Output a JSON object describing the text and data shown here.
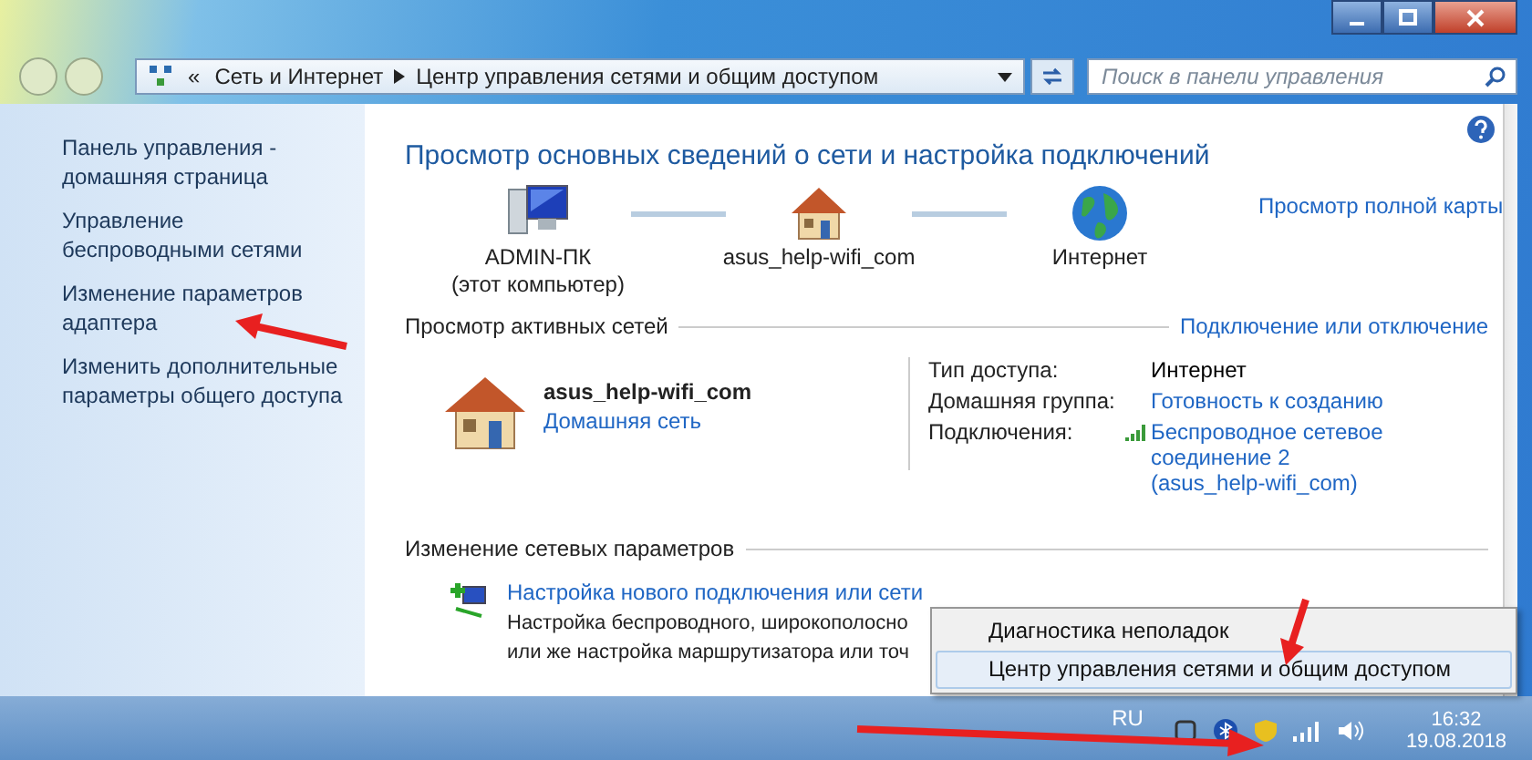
{
  "address_bar": {
    "overflow_mark": "«",
    "breadcrumbs": [
      "Сеть и Интернет",
      "Центр управления сетями и общим доступом"
    ]
  },
  "search": {
    "placeholder": "Поиск в панели управления"
  },
  "sidebar": {
    "items": [
      {
        "label": "Панель управления - домашняя страница"
      },
      {
        "label": "Управление беспроводными сетями"
      },
      {
        "label": "Изменение параметров адаптера"
      },
      {
        "label": "Изменить дополнительные параметры общего доступа"
      }
    ]
  },
  "main": {
    "title": "Просмотр основных сведений о сети и настройка подключений",
    "map": {
      "nodes": [
        {
          "kind": "computer",
          "label": "ADMIN-ПК",
          "sublabel": "(этот компьютер)"
        },
        {
          "kind": "house",
          "label": "asus_help-wifi_com"
        },
        {
          "kind": "globe",
          "label": "Интернет"
        }
      ],
      "full_map_link": "Просмотр полной карты"
    },
    "active_networks": {
      "heading": "Просмотр активных сетей",
      "link": "Подключение или отключение",
      "network": {
        "name": "asus_help-wifi_com",
        "type": "Домашняя сеть"
      },
      "details": [
        {
          "label": "Тип доступа:",
          "kind": "text",
          "value": "Интернет"
        },
        {
          "label": "Домашняя группа:",
          "kind": "link",
          "value": "Готовность к созданию"
        },
        {
          "label": "Подключения:",
          "kind": "signal-link",
          "value": "Беспроводное сетевое соединение 2 (asus_help-wifi_com)"
        }
      ]
    },
    "change_settings": {
      "heading": "Изменение сетевых параметров",
      "items": [
        {
          "title": "Настройка нового подключения или сети",
          "description_lines": [
            "Настройка беспроводного, широкополосно",
            "или же настройка маршрутизатора или точ"
          ]
        }
      ]
    }
  },
  "context_menu": {
    "items": [
      {
        "label": "Диагностика неполадок",
        "selected": false
      },
      {
        "label": "Центр управления сетями и общим доступом",
        "selected": true
      }
    ]
  },
  "taskbar": {
    "language": "RU",
    "time": "16:32",
    "date": "19.08.2018"
  }
}
